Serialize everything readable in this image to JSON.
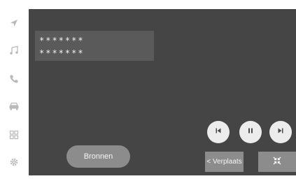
{
  "sidebar": {
    "items": [
      {
        "icon": "navigation-arrow-icon"
      },
      {
        "icon": "music-note-icon"
      },
      {
        "icon": "phone-icon"
      },
      {
        "icon": "car-icon"
      },
      {
        "icon": "apps-grid-icon"
      },
      {
        "icon": "settings-gear-icon"
      }
    ]
  },
  "media": {
    "line1": "*******",
    "line2": "*******"
  },
  "controls": {
    "previous_icon": "skip-previous-icon",
    "pause_icon": "pause-icon",
    "next_icon": "skip-next-icon",
    "sources_label": "Bronnen",
    "move_label": "< Verplaats",
    "shrink_icon": "shrink-icon"
  },
  "colors": {
    "screen_bg": "#454545",
    "button_bg": "#8c8c8c",
    "round_button_bg": "#ececec",
    "sidebar_icon": "#b9b9b9"
  }
}
